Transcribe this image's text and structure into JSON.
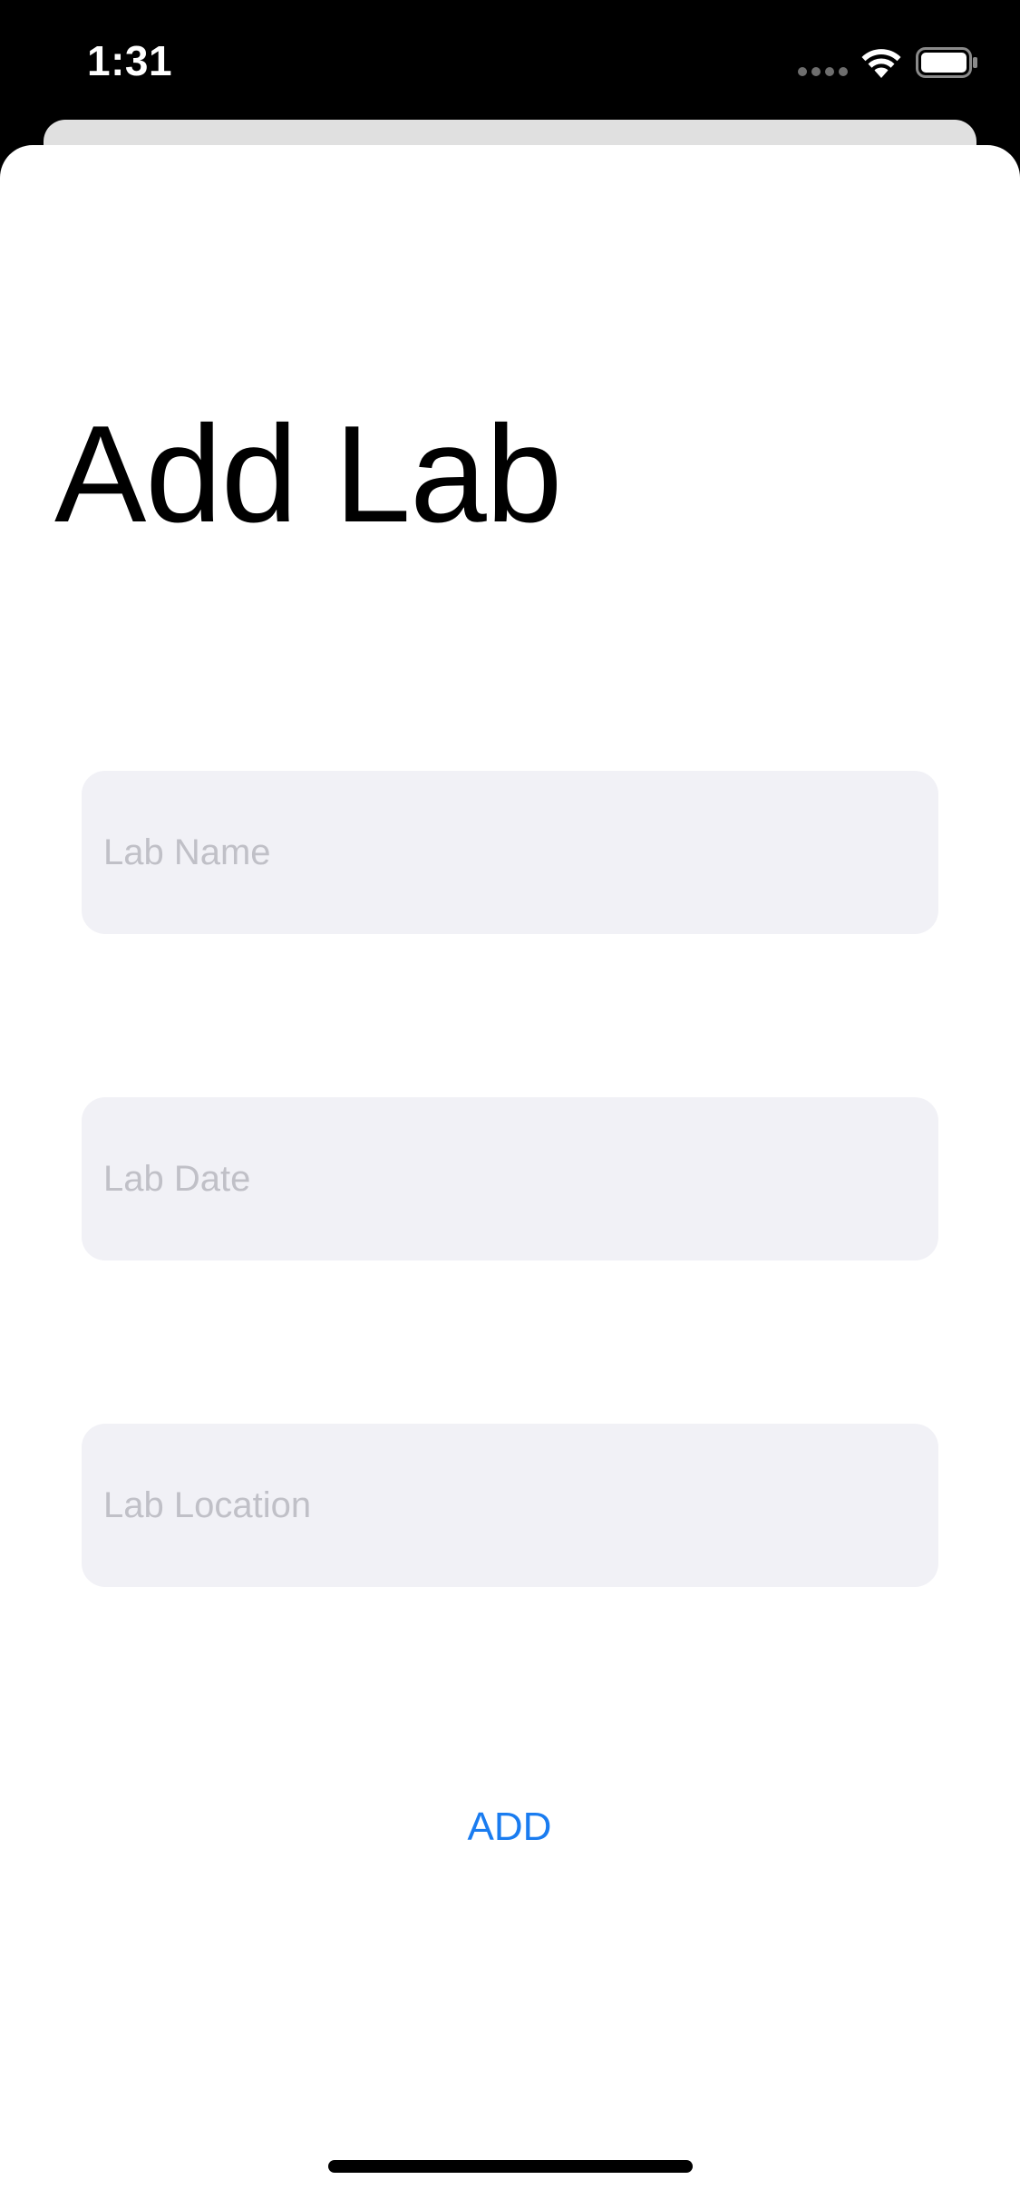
{
  "status_bar": {
    "time": "1:31",
    "icons": [
      "signal-icon",
      "wifi-icon",
      "battery-icon"
    ]
  },
  "form": {
    "title": "Add Lab",
    "fields": [
      {
        "name": "lab-name",
        "placeholder": "Lab Name",
        "value": ""
      },
      {
        "name": "lab-date",
        "placeholder": "Lab Date",
        "value": ""
      },
      {
        "name": "lab-location",
        "placeholder": "Lab Location",
        "value": ""
      }
    ],
    "add_label": "ADD"
  },
  "colors": {
    "accent": "#1a7cf0",
    "field_background": "#f1f1f6",
    "placeholder": "#c0c0c7"
  }
}
